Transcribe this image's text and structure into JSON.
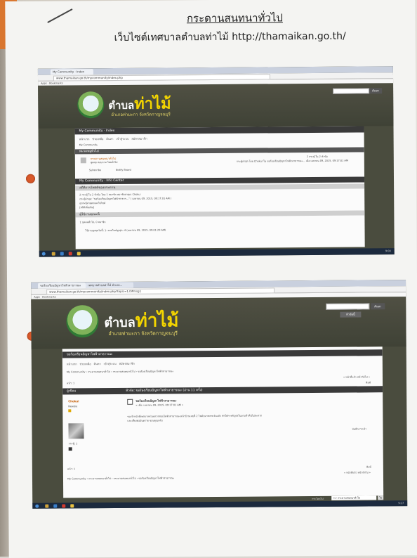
{
  "page": {
    "title": "กระดานสนทนาทั่วไป",
    "subtitle": "เว็บไซต์เทศบาลตำบลท่าไม้ http://thamaikan.go.th/"
  },
  "shot1": {
    "tab_label": "My Community · Index",
    "url": "www.thamaikan.go.th/mycommunity/index.php",
    "brand_small": "ตำบล",
    "brand_big": "ท่าไม้",
    "brand_sub": "อำเภอท่ามะกา จังหวัดกาญจนบุรี",
    "search_button": "ค้นหา",
    "header_bar": "My Community · Index",
    "nav_items": [
      "หน้าแรก",
      "ช่วยเหลือ",
      "ค้นหา",
      "เข้าสู่ระบบ",
      "สมัครสมาชิก"
    ],
    "crumb": "My Community",
    "board_category": "หมวดหมู่ทั่วไป",
    "board_name": "กระดานสนทนาทั่วไป",
    "board_desc": "พูดคุย สอบถาม โดยทั่วไป",
    "board_stats": "2 กระทู้ ใน 2 หัวข้อ",
    "last_post": "กระทู้ล่าสุด โดย Chokul ใน ขอร้องเรียนปัญหาไฟฟ้าสาธารณะ... เมื่อ เมษายน 09, 2015, 09:17:01 AM",
    "subscribe": "Subscribe",
    "notify": "Notify Board",
    "info_bar": "My Community · Info Center",
    "info_sub": "สถิติการโพสต์ของกระดาน",
    "info_line1": "2 กระทู้ ใน 2 หัวข้อ โดย 1 สมาชิก สมาชิกล่าสุด: Chokul",
    "info_line2": "กระทู้ล่าสุด: \"ขอร้องเรียนปัญหาไฟฟ้าสาธาร...\" ( เมษายน 09, 2015, 09:17:01 AM )",
    "info_line3": "ดูกระทู้ล่าสุดของเว็บไซต์",
    "info_line4": "[สถิติเพิ่มเติม]",
    "online_bar": "ผู้ใช้งานขณะนี้",
    "online_line1": "1 บุคคลทั่วไป, 0 สมาชิก",
    "online_line2": "ใช้งานสูงสุดวันนี้: 1. ออนไลน์สูงสุด: 4 (เมษายน 09, 2015, 09:01:29 AM)",
    "clock": "9:00"
  },
  "shot2": {
    "tab1": "ขอร้องเรียนปัญหาไฟฟ้าสาธารณะ",
    "tab2": "เทศบาลตำบลท่าไม้ อำเภอ...",
    "url": "www.thamaikan.go.th/mycommunity/index.php?topic=1.0#msg1",
    "brand_small": "ตำบล",
    "brand_big": "ท่าไม้",
    "brand_sub": "อำเภอท่ามะกา จังหวัดกาญจนบุรี",
    "search_button": "ค้นหา",
    "select_label": "หัวข้อนี้",
    "header_bar": "ขอร้องเรียนปัญหาไฟฟ้าสาธารณะ",
    "nav_items": [
      "หน้าแรก",
      "ช่วยเหลือ",
      "ค้นหา",
      "เข้าสู่ระบบ",
      "สมัครสมาชิก"
    ],
    "crumb": "My Community › กระดานสนทนาทั่วไป › กระดานสนทนาทั่วไป › ขอร้องเรียนปัญหาไฟฟ้าสาธารณะ",
    "pager": "หน้า: 1",
    "next_prev": "« หน้าที่แล้ว หน้าถัดไป »",
    "print": "พิมพ์",
    "col_author": "ผู้เขียน",
    "col_topic": "หัวข้อ: ขอร้องเรียนปัญหาไฟฟ้าสาธารณะ  (อ่าน 11 ครั้ง)",
    "author_name": "Chokul",
    "author_rank": "Newbie",
    "author_posts": "กระทู้: 1",
    "post_title": "ขอร้องเรียนปัญหาไฟฟ้าสาธารณะ",
    "post_date": "« เมื่อ: เมษายน 09, 2015, 09:17:01 AM »",
    "post_body1": "ขอเจ้าหน้าที่เทศบาลช่วยตรวจสอบไฟฟ้าสาธารณะหน้าบ้านเลขที่ 2 ไฟดับมาหลายวันแล้ว ทำให้การสัญจรในยามค่ำคืนไม่สะดวก",
    "post_body2": "และเสี่ยงต่ออันตราย ขอบคุณครับ",
    "logged": "บันทึกการเข้า",
    "jump_label": "กระโดดไป:",
    "jump_value": "=> กระดานสนทนาทั่วไป",
    "go": "ไป",
    "clock": "9:17"
  }
}
